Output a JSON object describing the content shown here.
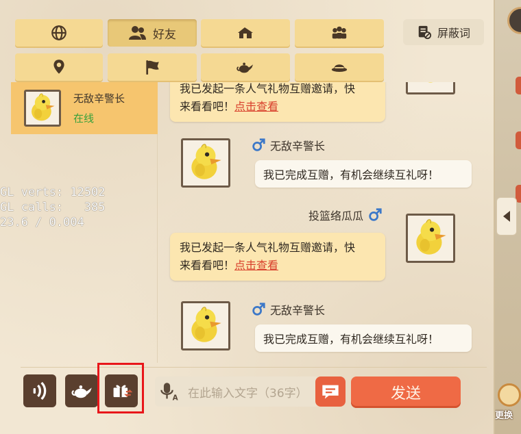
{
  "tabs": [
    {
      "name": "globe",
      "label": ""
    },
    {
      "name": "friends",
      "label": "好友"
    },
    {
      "name": "home",
      "label": ""
    },
    {
      "name": "group",
      "label": ""
    },
    {
      "name": "location",
      "label": ""
    },
    {
      "name": "flag",
      "label": ""
    },
    {
      "name": "teapot",
      "label": ""
    },
    {
      "name": "hat",
      "label": ""
    }
  ],
  "shield_button": {
    "label": "屏蔽词"
  },
  "friend": {
    "name": "无敌辛警长",
    "status": "在线"
  },
  "debug": {
    "line1": "GL verts: 12502",
    "line2": "GL calls:   385",
    "line3": "23.6 / 0.004"
  },
  "messages": [
    {
      "type": "invite",
      "text_lines": [
        "我已发起一条人气礼物互赠邀请，快",
        "来看看吧！"
      ],
      "link": "点击查看"
    },
    {
      "type": "reply",
      "sender": "无敌辛警长",
      "text": "我已完成互赠，有机会继续互礼呀！"
    },
    {
      "type": "invite",
      "sender": "投篮络瓜瓜",
      "text_lines": [
        "我已发起一条人气礼物互赠邀请，快",
        "来看看吧！"
      ],
      "link": "点击查看"
    },
    {
      "type": "reply",
      "sender": "无敌辛警长",
      "text": "我已完成互赠，有机会继续互礼呀！"
    }
  ],
  "input": {
    "placeholder": "在此输入文字（36字）"
  },
  "send_button": {
    "label": "发送"
  },
  "side": {
    "change_label": "更换"
  },
  "colors": {
    "accent": "#ef6a45",
    "tab": "#f5d993",
    "selected_row": "#f6c56e",
    "online": "#38a13b",
    "link": "#d8402c",
    "highlight": "#e8161a"
  }
}
